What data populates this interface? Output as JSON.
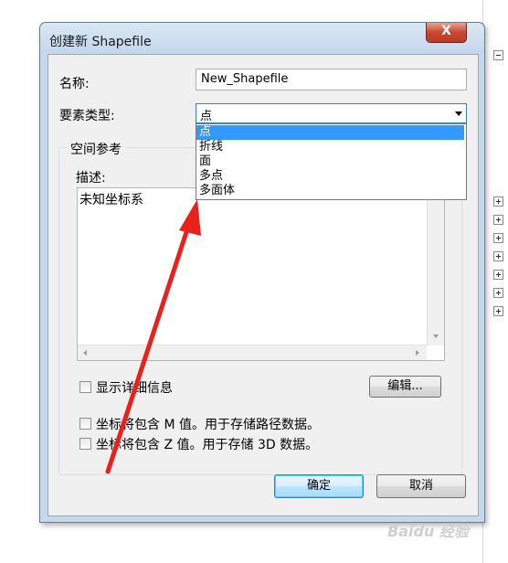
{
  "dialog": {
    "title": "创建新 Shapefile",
    "close_label": "X",
    "name_label": "名称:",
    "name_value": "New_Shapefile",
    "feature_type_label": "要素类型:",
    "feature_type_value": "点",
    "feature_type_options": [
      "点",
      "折线",
      "面",
      "多点",
      "多面体"
    ],
    "spatial_ref_group": "空间参考",
    "description_label": "描述:",
    "description_value": "未知坐标系",
    "show_details_label": "显示详细信息",
    "edit_button": "编辑...",
    "m_values_label": "坐标将包含 M 值。用于存储路径数据。",
    "z_values_label": "坐标将包含 Z 值。用于存储 3D 数据。",
    "ok_button": "确定",
    "cancel_button": "取消"
  },
  "watermark": "Baidu 经验",
  "annotation": {
    "color": "#e8211c"
  },
  "colors": {
    "selection": "#3399ff",
    "title_bar": "#c5d8ec"
  }
}
